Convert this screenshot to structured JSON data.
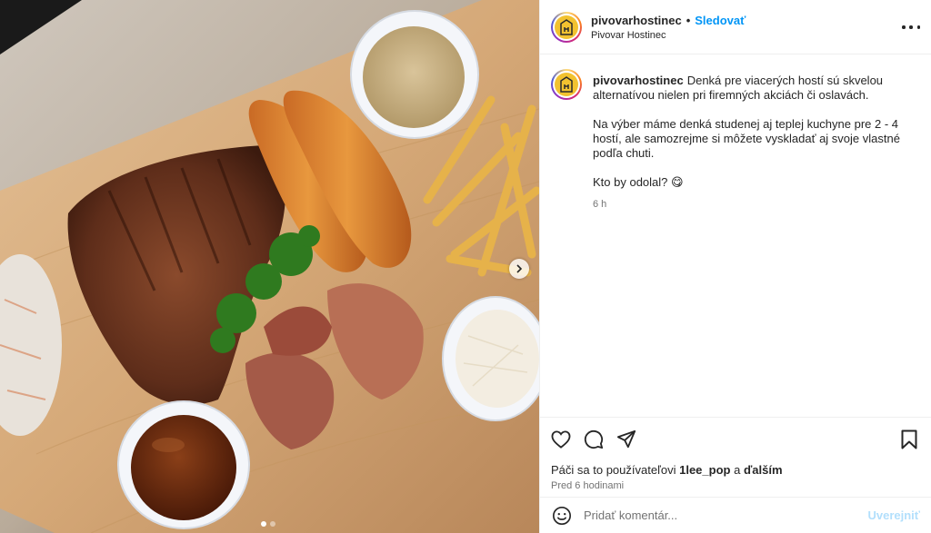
{
  "media": {
    "dots_count": 2,
    "active_dot": 1,
    "next_icon": "chevron-right-icon",
    "photo_subject": "food-platter"
  },
  "header": {
    "username": "pivovarhostinec",
    "separator": "•",
    "follow_label": "Sledovať",
    "subtitle": "Pivovar Hostinec",
    "more_icon": "more-options-icon"
  },
  "caption": {
    "username": "pivovarhostinec",
    "para1": "Denká pre viacerých hostí sú skvelou alternatívou nielen pri firemných akciách či oslavách.",
    "para2": "Na výber máme denká studenej aj teplej kuchyne pre 2 - 4 hostí, ale samozrejme si môžete vyskladať aj svoje vlastné podľa chuti.",
    "para3": "Kto by odolal? 😋",
    "time": "6 h"
  },
  "actions": {
    "like_icon": "heart-icon",
    "comment_icon": "comment-icon",
    "share_icon": "share-icon",
    "save_icon": "bookmark-icon",
    "likes_prefix": "Páči sa to používateľovi",
    "likes_user": "1lee_pop",
    "likes_mid": "a",
    "likes_others": "ďalším",
    "posted": "Pred 6 hodinami"
  },
  "comment_bar": {
    "emoji_icon": "emoji-icon",
    "placeholder": "Pridať komentár...",
    "post_label": "Uverejniť"
  },
  "colors": {
    "accent": "#0095f6",
    "post_disabled": "#b2dffc",
    "muted": "#737373",
    "text": "#262626"
  }
}
